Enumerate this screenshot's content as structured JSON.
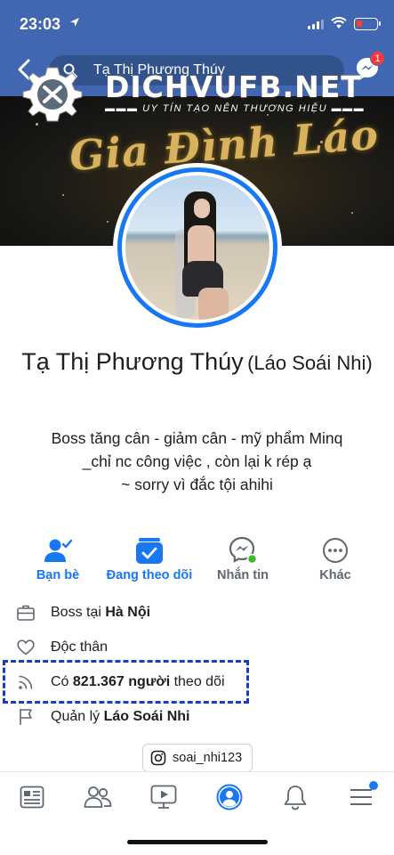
{
  "status_bar": {
    "time": "23:03"
  },
  "header": {
    "search_value": "Tạ Thị Phương Thúy",
    "messenger_badge": "1"
  },
  "watermark": {
    "title": "DICHVUFB.NET",
    "subtitle": "UY TÍN TẠO NÊN THƯƠNG HIỆU"
  },
  "cover": {
    "text": "Gia Đình Láo"
  },
  "profile": {
    "name": "Tạ Thị Phương Thúy",
    "alternate_name": "(Láo Soái Nhi)",
    "bio_lines": [
      "Boss tăng cân - giảm cân - mỹ phẩm Minq",
      "_chỉ nc công việc , còn lại k rép ạ",
      "~ sorry vì đắc tội ahihi"
    ]
  },
  "actions": [
    {
      "label": "Bạn bè",
      "icon": "friends-check-icon"
    },
    {
      "label": "Đang theo dõi",
      "icon": "following-icon"
    },
    {
      "label": "Nhắn tin",
      "icon": "messenger-icon"
    },
    {
      "label": "Khác",
      "icon": "more-icon"
    }
  ],
  "intro": {
    "work_prefix": "Boss tại ",
    "work_place": "Hà Nội",
    "relationship": "Độc thân",
    "followers_prefix": "Có ",
    "followers_count": "821.367 người",
    "followers_suffix": " theo dõi",
    "manages_prefix": "Quản lý ",
    "manages_page": "Láo Soái Nhi"
  },
  "instagram": {
    "handle": "soai_nhi123"
  },
  "colors": {
    "facebook_blue": "#4267b2",
    "accent_blue": "#1877f2",
    "highlight_dash": "#1a3cc8",
    "badge_red": "#fa383e"
  }
}
